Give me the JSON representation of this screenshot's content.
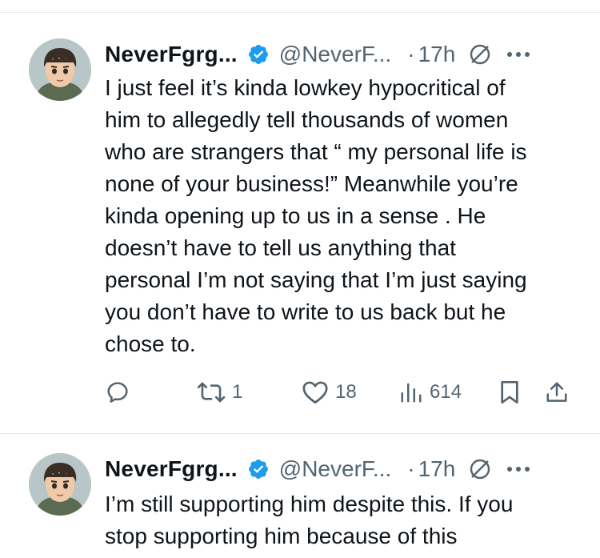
{
  "tweets": [
    {
      "display_name": "NeverFgrg...",
      "handle": "@NeverF...",
      "dot": "·",
      "time": "17h",
      "text_lines": [
        "I just feel it’s kinda lowkey hypocritical of",
        "him to allegedly tell thousands of women",
        "who are strangers that “ my personal life is",
        "none of your business!” Meanwhile you’re",
        "kinda opening up to us in a sense . He",
        "doesn’t have to tell us anything that",
        "personal I’m not saying that I’m just saying",
        "you don’t have to write to us back but he",
        "chose to."
      ],
      "actions": {
        "reply_count": "",
        "retweet_count": "1",
        "like_count": "18",
        "views_count": "614"
      }
    },
    {
      "display_name": "NeverFgrg...",
      "handle": "@NeverF...",
      "dot": "·",
      "time": "17h",
      "text_lines": [
        "I’m still supporting him despite this. If you",
        "stop supporting him because of this"
      ]
    }
  ],
  "icons": {
    "verified": "verified-badge-icon",
    "grok": "grok-icon",
    "more": "more-icon",
    "reply": "reply-icon",
    "retweet": "retweet-icon",
    "like": "heart-icon",
    "views": "views-icon",
    "bookmark": "bookmark-icon",
    "share": "share-icon"
  },
  "colors": {
    "text": "#0f1419",
    "secondary": "#536471",
    "verified": "#1d9bf0",
    "divider": "#e6e8ea"
  }
}
